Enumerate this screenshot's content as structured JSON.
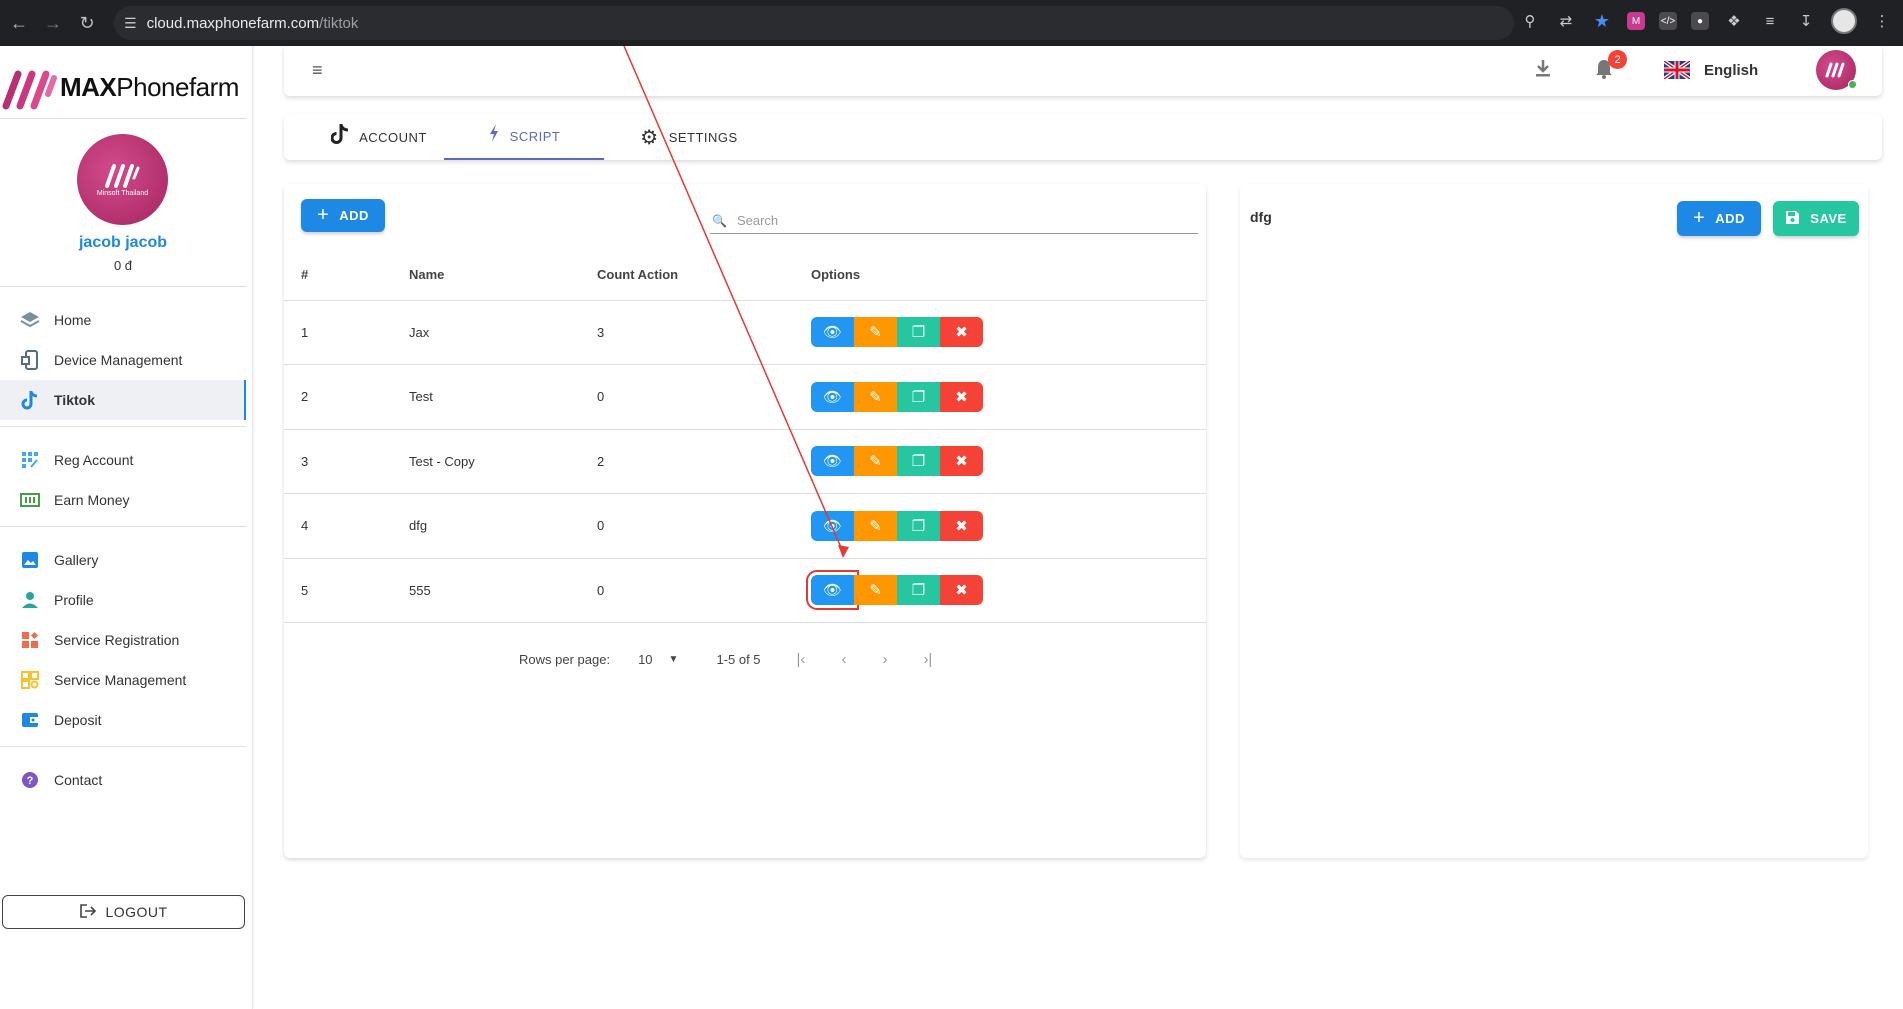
{
  "browser": {
    "url_host": "cloud.maxphonefarm.com",
    "url_path": "/tiktok"
  },
  "brand": {
    "name_bold": "MAX",
    "name_light": "Phonefarm"
  },
  "user": {
    "name": "jacob jacob",
    "balance": "0 đ",
    "avatar_caption": "Minsoft Thailand"
  },
  "sidebar": {
    "group1": [
      {
        "label": "Home",
        "icon": "layers-icon"
      },
      {
        "label": "Device Management",
        "icon": "device-icon"
      },
      {
        "label": "Tiktok",
        "icon": "tiktok-icon",
        "active": true
      }
    ],
    "group2": [
      {
        "label": "Reg Account",
        "icon": "reg-account-icon"
      },
      {
        "label": "Earn Money",
        "icon": "money-icon"
      }
    ],
    "group3": [
      {
        "label": "Gallery",
        "icon": "image-icon"
      },
      {
        "label": "Profile",
        "icon": "person-icon"
      },
      {
        "label": "Service Registration",
        "icon": "service-registration-icon"
      },
      {
        "label": "Service Management",
        "icon": "service-management-icon"
      },
      {
        "label": "Deposit",
        "icon": "wallet-icon"
      }
    ],
    "group4": [
      {
        "label": "Contact",
        "icon": "help-icon"
      }
    ],
    "logout_label": "LOGOUT"
  },
  "header": {
    "notification_count": "2",
    "language": "English"
  },
  "tabs": [
    {
      "label": "ACCOUNT",
      "icon": "tiktok-icon"
    },
    {
      "label": "SCRIPT",
      "icon": "flash-icon",
      "active": true
    },
    {
      "label": "SETTINGS",
      "icon": "gear-icon"
    }
  ],
  "scripts": {
    "add_label": "ADD",
    "search_placeholder": "Search",
    "columns": [
      "#",
      "Name",
      "Count Action",
      "Options"
    ],
    "rows": [
      {
        "idx": "1",
        "name": "Jax",
        "count": "3"
      },
      {
        "idx": "2",
        "name": "Test",
        "count": "0"
      },
      {
        "idx": "3",
        "name": "Test - Copy",
        "count": "2"
      },
      {
        "idx": "4",
        "name": "dfg",
        "count": "0"
      },
      {
        "idx": "5",
        "name": "555",
        "count": "0"
      }
    ],
    "pagination": {
      "rows_per_page_label": "Rows per page:",
      "rows_per_page": "10",
      "range": "1-5 of 5"
    }
  },
  "detail": {
    "title": "dfg",
    "add_label": "ADD",
    "save_label": "SAVE"
  },
  "colors": {
    "primary": "#1e88e5",
    "view": "#2196f3",
    "edit": "#ff9800",
    "copy": "#26c6a0",
    "delete": "#f44336",
    "brand": "#b8306f",
    "tab_active": "#5c6bc0",
    "annotation": "#e53935"
  }
}
